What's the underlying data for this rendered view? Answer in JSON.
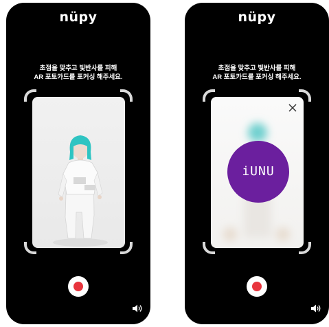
{
  "screens": [
    {
      "logo": "nüpy",
      "instruction_line1": "초점을 맞추고 빛반사를 피해",
      "instruction_line2": "AR 포토카드를 포커싱 해주세요.",
      "state": "photocard-preview"
    },
    {
      "logo": "nüpy",
      "instruction_line1": "초점을 맞추고 빛반사를 피해",
      "instruction_line2": "AR 포토카드를 포커싱 해주세요.",
      "state": "ar-recognized",
      "ar_logo_text": "iUNU"
    }
  ],
  "icons": {
    "record": "record-icon",
    "sound": "speaker-icon",
    "close": "close-icon"
  },
  "colors": {
    "background": "#000000",
    "accent_record": "#e8343d",
    "ar_disc": "#6b1f9e",
    "hair": "#2fc4c2"
  }
}
